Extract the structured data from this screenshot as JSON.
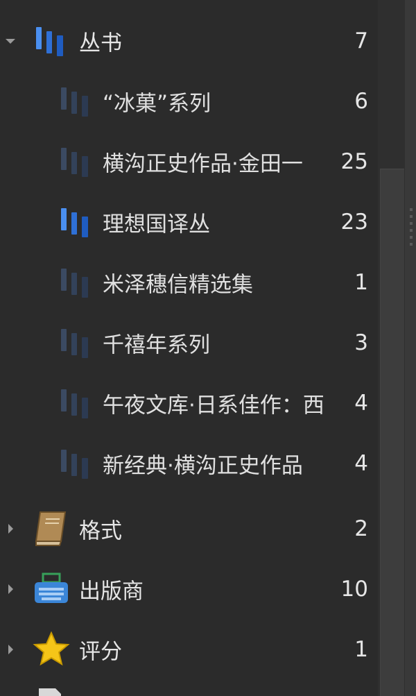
{
  "tree": {
    "series": {
      "label": "丛书",
      "count": "7",
      "icon": "series-icon",
      "expanded": true,
      "children": [
        {
          "label": "“冰菓”系列",
          "count": "6",
          "highlight": false
        },
        {
          "label": "横沟正史作品·金田一",
          "count": "25",
          "highlight": false
        },
        {
          "label": "理想国译丛",
          "count": "23",
          "highlight": true
        },
        {
          "label": "米泽穗信精选集",
          "count": "1",
          "highlight": false
        },
        {
          "label": "千禧年系列",
          "count": "3",
          "highlight": false
        },
        {
          "label": "午夜文库·日系佳作：西",
          "count": "4",
          "highlight": false
        },
        {
          "label": "新经典·横沟正史作品",
          "count": "4",
          "highlight": false
        }
      ]
    },
    "format": {
      "label": "格式",
      "count": "2",
      "icon": "book-icon"
    },
    "publisher": {
      "label": "出版商",
      "count": "10",
      "icon": "typewriter-icon"
    },
    "rating": {
      "label": "评分",
      "count": "1",
      "icon": "star-icon"
    }
  },
  "colors": {
    "background": "#2b2b2b",
    "series_active": "#3a7de0",
    "series_dim": "#3a4f70",
    "book_tan": "#b08a55",
    "publisher_blue": "#3b86d8",
    "star_yellow": "#f5c518"
  }
}
